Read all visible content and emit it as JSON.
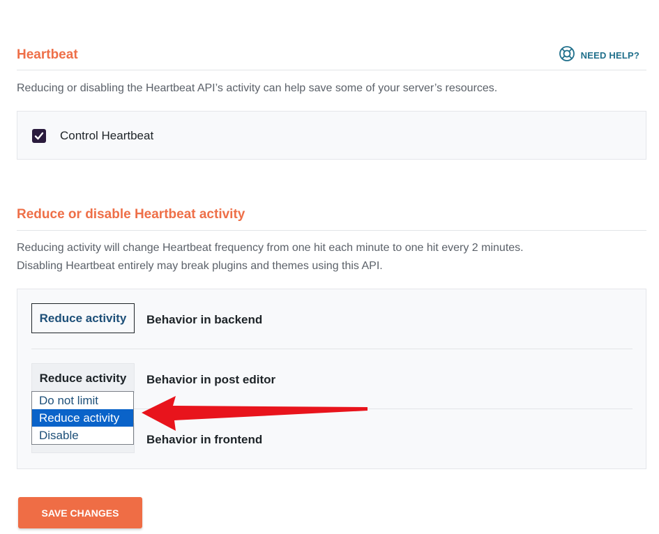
{
  "heartbeat_section": {
    "title": "Heartbeat",
    "help_label": "NEED HELP?",
    "description": "Reducing or disabling the Heartbeat API’s activity can help save some of your server’s resources.",
    "control_label": "Control Heartbeat",
    "control_checked": true
  },
  "reduce_section": {
    "title": "Reduce or disable Heartbeat activity",
    "description_line1": "Reducing activity will change Heartbeat frequency from one hit each minute to one hit every 2 minutes.",
    "description_line2": "Disabling Heartbeat entirely may break plugins and themes using this API.",
    "rows": [
      {
        "select_value": "Reduce activity",
        "label": "Behavior in backend"
      },
      {
        "select_value": "Reduce activity",
        "label": "Behavior in post editor"
      },
      {
        "select_value": "Reduce activity",
        "label": "Behavior in frontend"
      }
    ],
    "dropdown_options": [
      "Do not limit",
      "Reduce activity",
      "Disable"
    ],
    "dropdown_selected": "Reduce activity"
  },
  "save_button_label": "SAVE CHANGES",
  "colors": {
    "accent": "#ee6f48",
    "help": "#1f6f8b",
    "checkbox": "#2a1b3d",
    "dropdown_highlight": "#0a63c9",
    "annotation_arrow": "#e8141c"
  },
  "icons": {
    "help": "lifebuoy-icon",
    "check": "checkmark-icon",
    "annotation": "red-arrow-annotation"
  }
}
